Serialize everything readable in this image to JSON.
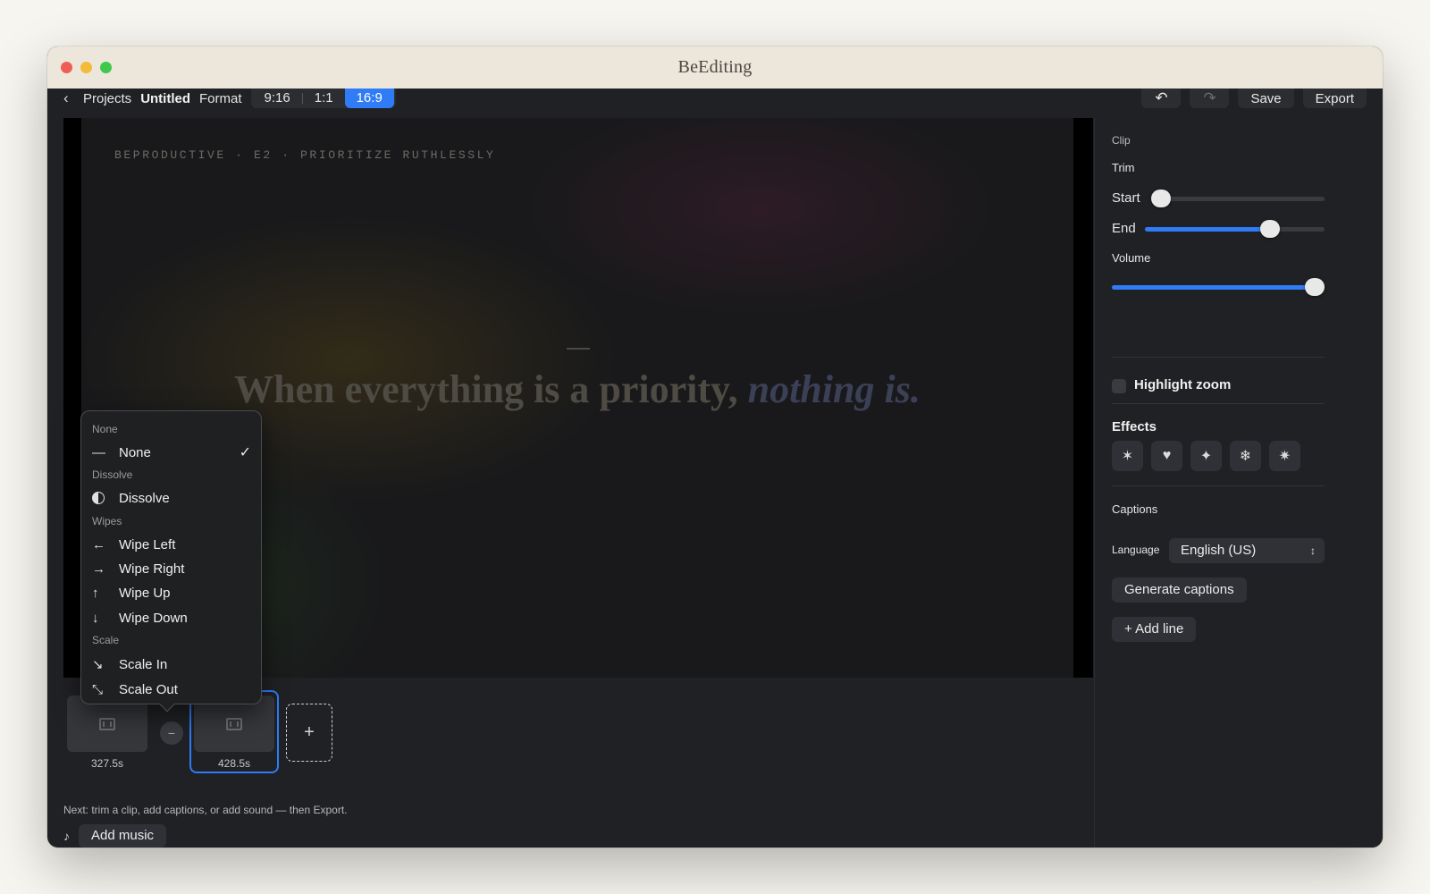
{
  "window": {
    "title": "BeEditing"
  },
  "toolbar": {
    "back_label": "Projects",
    "project_name": "Untitled",
    "format_label": "Format",
    "formats": [
      "9:16",
      "1:1",
      "16:9"
    ],
    "active_format": "16:9",
    "save_label": "Save",
    "export_label": "Export"
  },
  "preview": {
    "eyebrow": "BEPRODUCTIVE · E2 · PRIORITIZE RUTHLESSLY",
    "headline_main": "When everything is a priority, ",
    "headline_emphasis": "nothing is."
  },
  "transition_menu": {
    "sections": [
      {
        "title": "None",
        "items": [
          {
            "label": "None",
            "icon": "dash-icon",
            "checked": true
          }
        ]
      },
      {
        "title": "Dissolve",
        "items": [
          {
            "label": "Dissolve",
            "icon": "half-circle-icon"
          }
        ]
      },
      {
        "title": "Wipes",
        "items": [
          {
            "label": "Wipe Left",
            "icon": "arrow-left-icon"
          },
          {
            "label": "Wipe Right",
            "icon": "arrow-right-icon"
          },
          {
            "label": "Wipe Up",
            "icon": "arrow-up-icon"
          },
          {
            "label": "Wipe Down",
            "icon": "arrow-down-icon"
          }
        ]
      },
      {
        "title": "Scale",
        "items": [
          {
            "label": "Scale In",
            "icon": "scale-in-icon"
          },
          {
            "label": "Scale Out",
            "icon": "scale-out-icon"
          }
        ]
      }
    ]
  },
  "timeline": {
    "clips": [
      {
        "duration": "327.5s",
        "selected": false
      },
      {
        "duration": "428.5s",
        "selected": true
      }
    ],
    "hint": "Next: trim a clip, add captions, or add sound — then Export.",
    "add_music_label": "Add music"
  },
  "sidebar": {
    "clip_section": "Clip",
    "trim_label": "Trim",
    "start_label": "Start",
    "end_label": "End",
    "volume_label": "Volume",
    "trim_start": 0.0,
    "trim_end": 0.7,
    "volume": 1.0,
    "highlight_zoom_label": "Highlight zoom",
    "highlight_zoom_checked": false,
    "effects_label": "Effects",
    "effects": [
      "party-popper-icon",
      "heart-icon",
      "sparkle-icon",
      "snowflake-icon",
      "sparkles-icon"
    ],
    "captions_label": "Captions",
    "language_label": "Language",
    "language_value": "English (US)",
    "generate_captions_label": "Generate captions",
    "add_line_label": "+ Add line"
  },
  "colors": {
    "accent": "#2f7cf6",
    "window_bg": "#202124",
    "titlebar_bg": "#ede6da"
  }
}
